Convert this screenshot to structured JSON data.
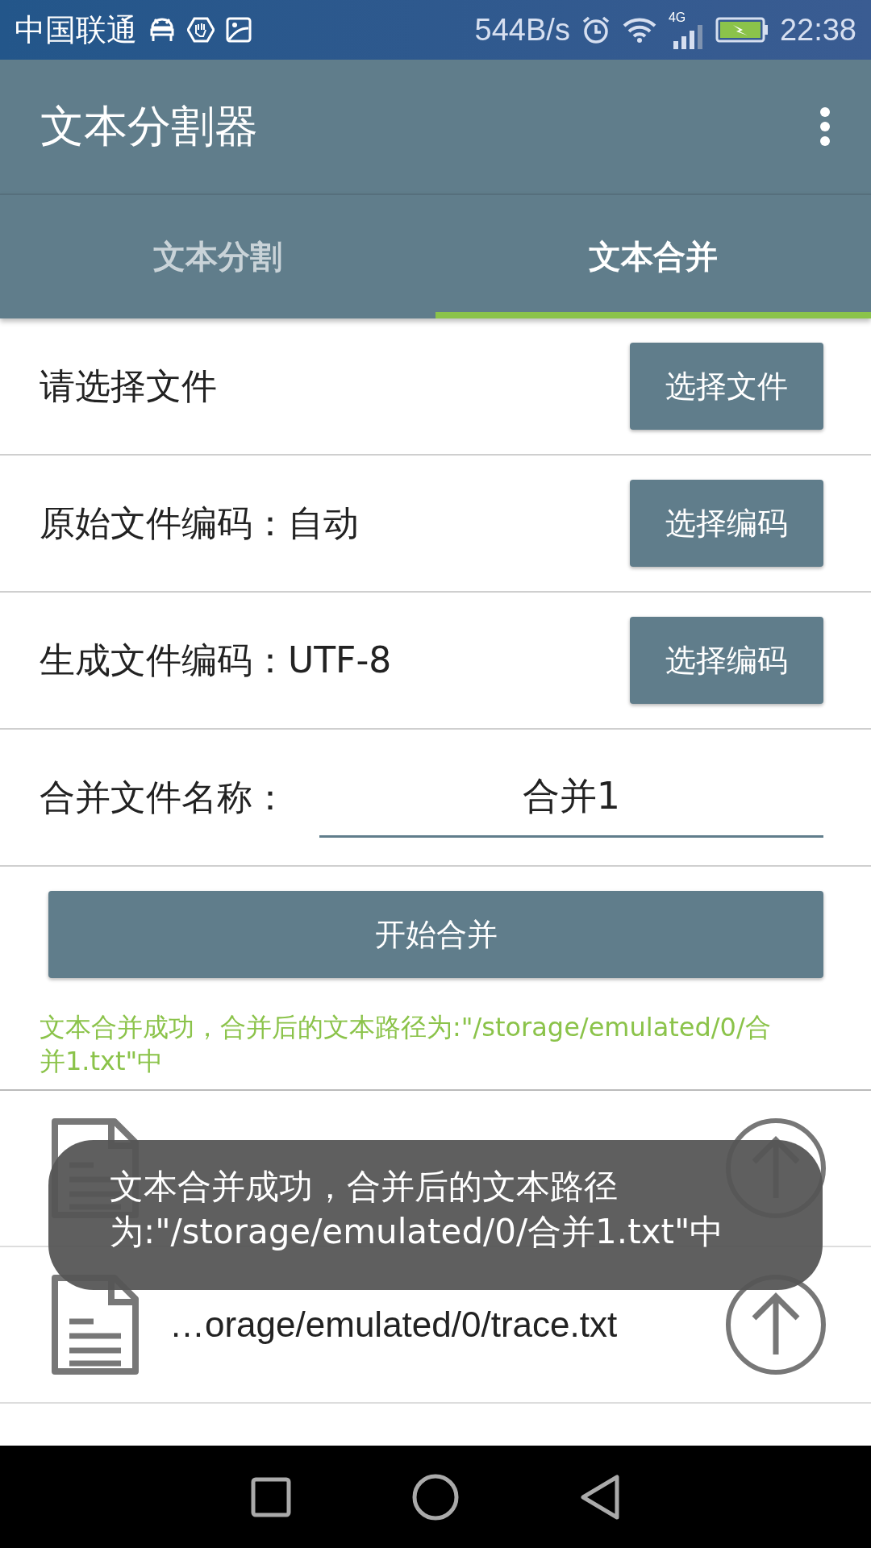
{
  "status_bar": {
    "carrier": "中国联通",
    "speed": "544B/s",
    "network": "4G",
    "time": "22:38"
  },
  "app_bar": {
    "title": "文本分割器"
  },
  "tabs": [
    {
      "label": "文本分割",
      "selected": false
    },
    {
      "label": "文本合并",
      "selected": true
    }
  ],
  "settings": [
    {
      "kind": "button",
      "label": "请选择文件",
      "button": "选择文件"
    },
    {
      "kind": "button",
      "label": "原始文件编码：自动",
      "button": "选择编码"
    },
    {
      "kind": "button",
      "label": "生成文件编码：UTF-8",
      "button": "选择编码"
    },
    {
      "kind": "input",
      "label": "合并文件名称：",
      "value": "合并1"
    }
  ],
  "merge_button": "开始合并",
  "result_message": "文本合并成功，合并后的文本路径为:\"/storage/emulated/0/合并1.txt\"中",
  "files": [
    {
      "kind": "covered"
    },
    {
      "kind": "shown",
      "path": "…orage/emulated/0/trace.txt"
    }
  ],
  "toast": "文本合并成功，合并后的文本路径为:\"/storage/emulated/0/合并1.txt\"中"
}
